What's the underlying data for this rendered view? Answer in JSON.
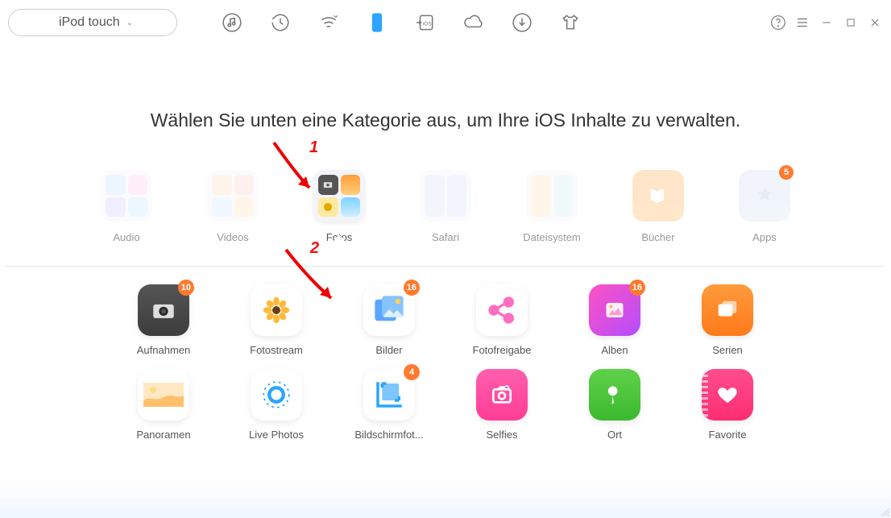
{
  "toolbar": {
    "device_label": "iPod touch"
  },
  "heading": "Wählen Sie unten eine Kategorie aus, um Ihre iOS Inhalte zu verwalten.",
  "annotations": {
    "one": "1",
    "two": "2"
  },
  "categories": [
    {
      "label": "Audio"
    },
    {
      "label": "Videos"
    },
    {
      "label": "Fotos",
      "active": true
    },
    {
      "label": "Safari"
    },
    {
      "label": "Dateisystem"
    },
    {
      "label": "Bücher"
    },
    {
      "label": "Apps",
      "badge": "5"
    }
  ],
  "photos_items": [
    {
      "label": "Aufnahmen",
      "badge": "10",
      "icon": "camera"
    },
    {
      "label": "Fotostream",
      "icon": "flower"
    },
    {
      "label": "Bilder",
      "badge": "16",
      "icon": "picture"
    },
    {
      "label": "Fotofreigabe",
      "icon": "share"
    },
    {
      "label": "Alben",
      "badge": "16",
      "icon": "album"
    },
    {
      "label": "Serien",
      "icon": "burst"
    },
    {
      "label": "Panoramen",
      "icon": "panorama"
    },
    {
      "label": "Live Photos",
      "icon": "live"
    },
    {
      "label": "Bildschirmfot...",
      "badge": "4",
      "icon": "screenshot"
    },
    {
      "label": "Selfies",
      "icon": "selfie"
    },
    {
      "label": "Ort",
      "icon": "pin"
    },
    {
      "label": "Favorite",
      "icon": "heart"
    }
  ]
}
